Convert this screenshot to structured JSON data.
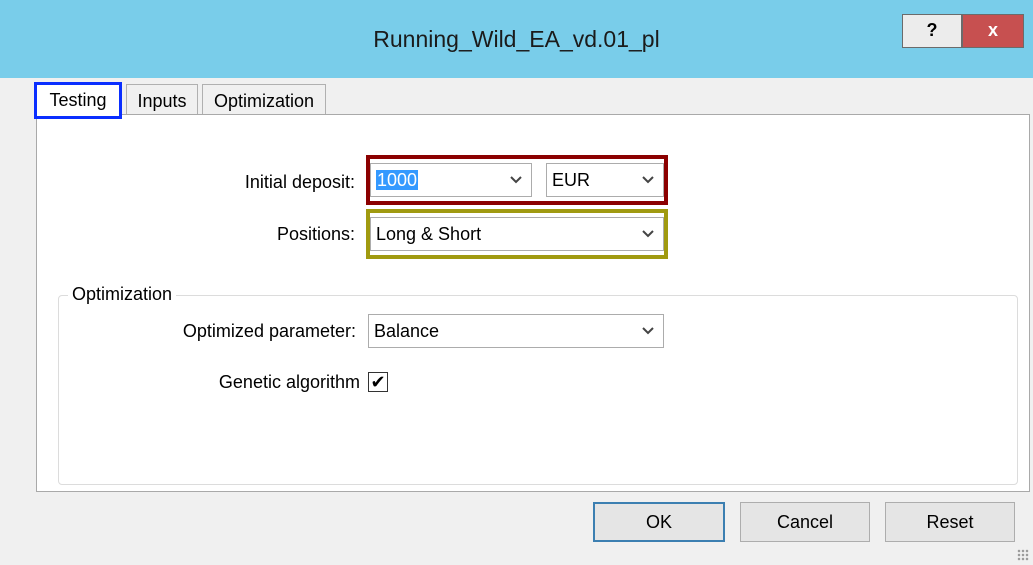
{
  "window": {
    "title": "Running_Wild_EA_vd.01_pl",
    "help_label": "?",
    "close_label": "x"
  },
  "tabs": [
    {
      "label": "Testing",
      "active": true
    },
    {
      "label": "Inputs",
      "active": false
    },
    {
      "label": "Optimization",
      "active": false
    }
  ],
  "testing": {
    "initial_deposit_label": "Initial deposit:",
    "initial_deposit_value": "1000",
    "currency_value": "EUR",
    "positions_label": "Positions:",
    "positions_value": "Long & Short"
  },
  "optimization_group": {
    "title": "Optimization",
    "optimized_parameter_label": "Optimized parameter:",
    "optimized_parameter_value": "Balance",
    "genetic_algorithm_label": "Genetic algorithm",
    "genetic_algorithm_checked": true,
    "check_glyph": "✔"
  },
  "buttons": {
    "ok": "OK",
    "cancel": "Cancel",
    "reset": "Reset"
  },
  "icons": {
    "dropdown": "chevron-down-icon",
    "check": "checkmark-icon"
  },
  "colors": {
    "titlebar": "#79cdea",
    "close_button": "#c75050",
    "tab_highlight": "#0a2eff",
    "deposit_highlight": "#8b0000",
    "positions_highlight": "#a09a10",
    "selection": "#3399ff"
  }
}
